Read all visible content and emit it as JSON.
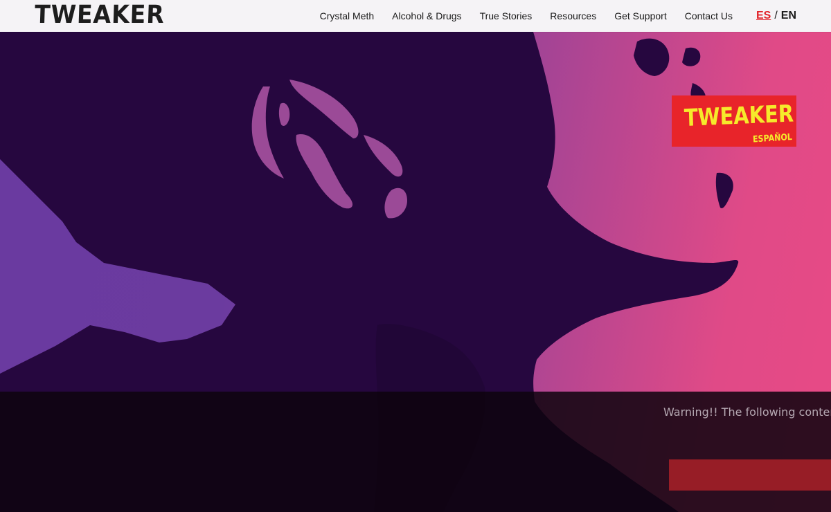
{
  "header": {
    "logo_text": "TWEAKER",
    "nav": [
      {
        "label": "Crystal Meth"
      },
      {
        "label": "Alcohol & Drugs"
      },
      {
        "label": "True Stories"
      },
      {
        "label": "Resources"
      },
      {
        "label": "Get Support"
      },
      {
        "label": "Contact Us"
      }
    ],
    "lang": {
      "es": "ES",
      "separator": "/",
      "en": "EN"
    }
  },
  "badge": {
    "logo_text": "TWEAKER",
    "subtitle": "ESPAÑOL",
    "color": "#e8242a",
    "text_color": "#f6ea2b"
  },
  "warning": {
    "text": "Warning!! The following content",
    "button_color": "#971d26"
  },
  "colors": {
    "silhouette": "#26073f",
    "accent_red": "#e12229",
    "gradient_left": "#6a3aa0",
    "gradient_right": "#e84a86"
  }
}
